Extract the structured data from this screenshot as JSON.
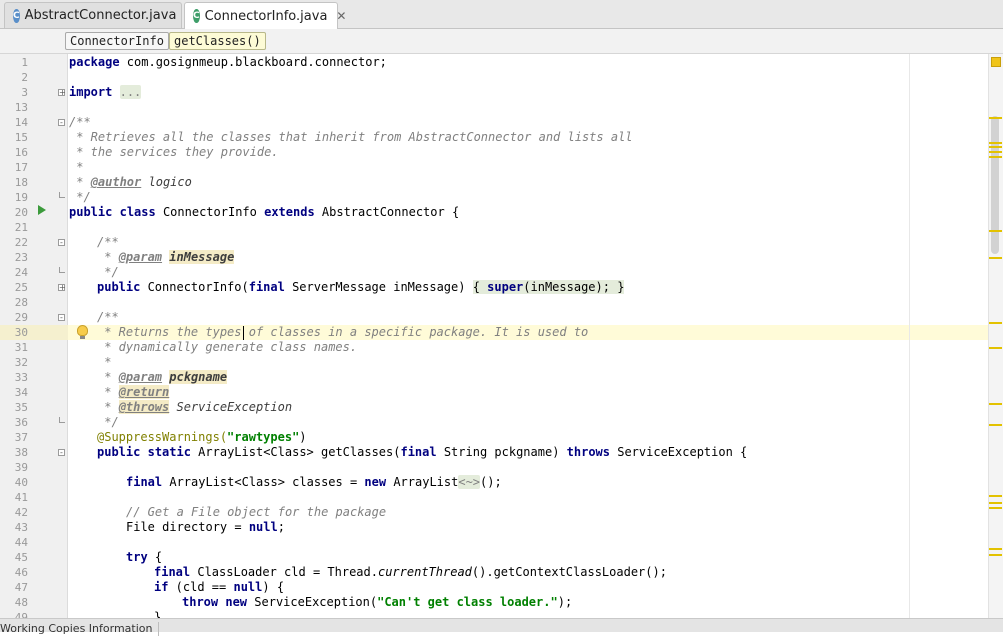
{
  "tabs": [
    {
      "label": "AbstractConnector.java",
      "icon": "C",
      "active": false
    },
    {
      "label": "ConnectorInfo.java",
      "icon": "C",
      "active": true
    }
  ],
  "breadcrumbs": [
    "ConnectorInfo",
    "getClasses()"
  ],
  "line_numbers": [
    "1",
    "2",
    "3",
    "13",
    "14",
    "15",
    "16",
    "17",
    "18",
    "19",
    "20",
    "21",
    "22",
    "23",
    "24",
    "25",
    "28",
    "29",
    "30",
    "31",
    "32",
    "33",
    "34",
    "35",
    "36",
    "37",
    "38",
    "39",
    "40",
    "41",
    "42",
    "43",
    "44",
    "45",
    "46",
    "47",
    "48",
    "49"
  ],
  "code": {
    "l1_kw": "package",
    "l1_rest": " com.gosignmeup.blackboard.connector;",
    "l3_kw": "import",
    "l3_fold": "...",
    "l14": "/**",
    "l15": " * Retrieves all the classes that inherit from AbstractConnector and lists all",
    "l16": " * the services they provide.",
    "l17": " *",
    "l18_pre": " * ",
    "l18_tag": "@author",
    "l18_val": " logico",
    "l19": " */",
    "l20_kw1": "public",
    "l20_kw2": "class",
    "l20_name": " ConnectorInfo ",
    "l20_kw3": "extends",
    "l20_rest": " AbstractConnector {",
    "l22": "/**",
    "l23_pre": " * ",
    "l23_tag": "@param",
    "l23_param": "inMessage",
    "l24": " */",
    "l25_kw1": "public",
    "l25_a": " ConnectorInfo(",
    "l25_kw2": "final",
    "l25_b": " ServerMessage inMessage) ",
    "l25_c": "{ ",
    "l25_kw3": "super",
    "l25_d": "(inMessage); }",
    "l29": "/**",
    "l30a": " * Returns the types ",
    "l30b": "of classes in a specific package. It is used to",
    "l31": " * dynamically generate class names.",
    "l32": " *",
    "l33_pre": " * ",
    "l33_tag": "@param",
    "l33_param": "pckgname",
    "l34_pre": " * ",
    "l34_tag": "@return",
    "l35_pre": " * ",
    "l35_tag": "@throws",
    "l35_val": " ServiceException",
    "l36": " */",
    "l37_ann": "@SuppressWarnings(",
    "l37_str": "\"rawtypes\"",
    "l37_end": ")",
    "l38_kw1": "public",
    "l38_kw2": "static",
    "l38_a": " ArrayList<Class> getClasses(",
    "l38_kw3": "final",
    "l38_b": " String pckgname) ",
    "l38_kw4": "throws",
    "l38_c": " ServiceException {",
    "l40_kw1": "final",
    "l40_a": " ArrayList<Class> classes = ",
    "l40_kw2": "new",
    "l40_b": " ArrayList",
    "l40_diamond": "<~>",
    "l40_c": "();",
    "l42": "// Get a File object for the package",
    "l43_a": "File directory = ",
    "l43_kw": "null",
    "l43_b": ";",
    "l45_kw": "try",
    "l45_a": " {",
    "l46_kw": "final",
    "l46_a": " ClassLoader cld = Thread.",
    "l46_stat": "currentThread",
    "l46_b": "().getContextClassLoader();",
    "l47_kw": "if",
    "l47_a": " (cld == ",
    "l47_kw2": "null",
    "l47_b": ") {",
    "l48_kw1": "throw",
    "l48_kw2": "new",
    "l48_a": " ServiceException(",
    "l48_str": "\"Can't get class loader.\"",
    "l48_b": ");",
    "l49": "}"
  },
  "bottom_tab": "Working Copies Information",
  "colors": {
    "keyword": "#000080",
    "string": "#008000",
    "comment": "#808080",
    "annotation": "#808000",
    "marker": "#e3c200"
  }
}
